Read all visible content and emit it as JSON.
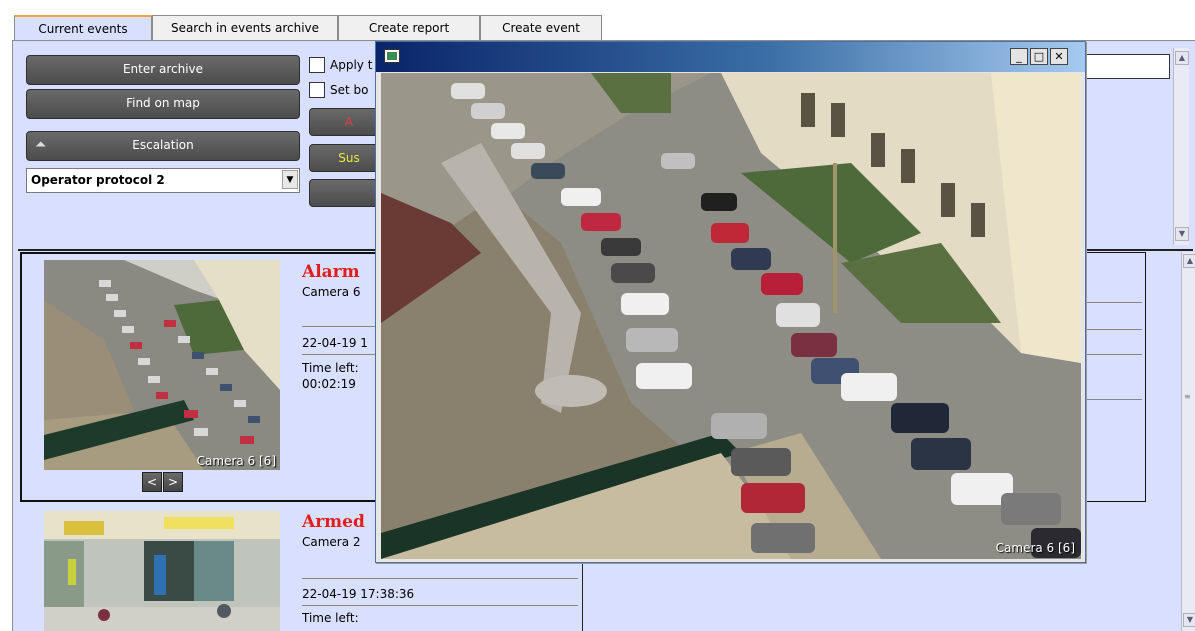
{
  "tabs": [
    {
      "label": "Current events",
      "active": true
    },
    {
      "label": "Search in events archive",
      "active": false
    },
    {
      "label": "Create report",
      "active": false
    },
    {
      "label": "Create event",
      "active": false
    }
  ],
  "controls": {
    "enter_archive": "Enter archive",
    "find_on_map": "Find on map",
    "escalation": "Escalation",
    "protocol_select": "Operator protocol 2",
    "apply_label": "Apply t",
    "set_label": "Set bo",
    "alarm_btn_fragment": "A",
    "suspend_btn_fragment": "Sus"
  },
  "events": [
    {
      "type": "Alarm",
      "camera": "Camera 6",
      "datetime": "22-04-19 1",
      "time_left_label": "Time left:",
      "time_left": "00:02:19",
      "thumb_label": "Camera 6 [6]",
      "prev": "<",
      "next": ">"
    },
    {
      "type": "Armed",
      "camera": "Camera 2",
      "datetime": "22-04-19 17:38:36",
      "time_left_label": "Time left:"
    }
  ],
  "video_window": {
    "camera_label": "Camera 6 [6]",
    "minimize": "_",
    "maximize": "□",
    "close": "✕"
  },
  "colors": {
    "panel_bg": "#d9dfff",
    "event_type": "#e01e1e",
    "tab_accent": "#f4a43a",
    "titlebar": "#0a246a"
  }
}
